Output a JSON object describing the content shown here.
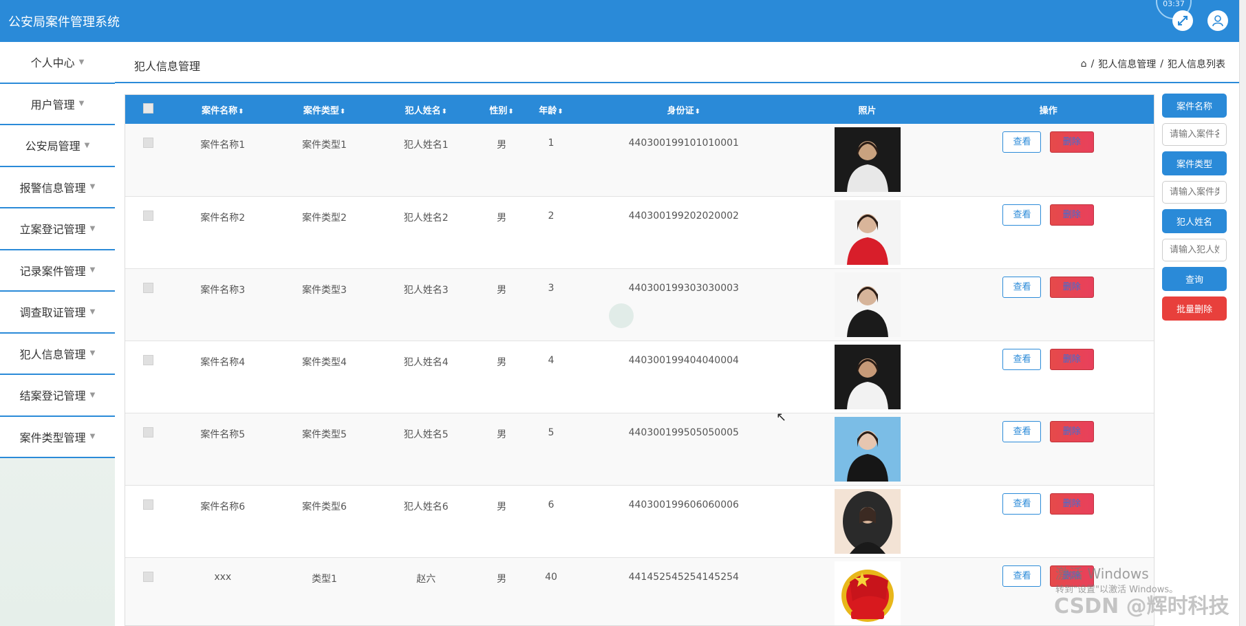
{
  "app": {
    "title": "公安局案件管理系统",
    "clock": "03:37"
  },
  "sidebar": {
    "items": [
      {
        "label": "个人中心"
      },
      {
        "label": "用户管理"
      },
      {
        "label": "公安局管理"
      },
      {
        "label": "报警信息管理"
      },
      {
        "label": "立案登记管理"
      },
      {
        "label": "记录案件管理"
      },
      {
        "label": "调查取证管理"
      },
      {
        "label": "犯人信息管理"
      },
      {
        "label": "结案登记管理"
      },
      {
        "label": "案件类型管理"
      }
    ]
  },
  "header": {
    "page_title": "犯人信息管理",
    "breadcrumb": [
      "犯人信息管理",
      "犯人信息列表"
    ],
    "separator": "/"
  },
  "table": {
    "columns": [
      "案件名称",
      "案件类型",
      "犯人姓名",
      "性别",
      "年龄",
      "身份证",
      "照片",
      "操作"
    ],
    "sortable": [
      true,
      true,
      true,
      true,
      true,
      true,
      false,
      false
    ],
    "view_label": "查看",
    "delete_label": "删除",
    "rows": [
      {
        "case_name": "案件名称1",
        "case_type": "案件类型1",
        "criminal_name": "犯人姓名1",
        "gender": "男",
        "age": "1",
        "id_card": "440300199101010001",
        "photo": "man-in-suit-photo"
      },
      {
        "case_name": "案件名称2",
        "case_type": "案件类型2",
        "criminal_name": "犯人姓名2",
        "gender": "男",
        "age": "2",
        "id_card": "440300199202020002",
        "photo": "woman-red-jacket-photo"
      },
      {
        "case_name": "案件名称3",
        "case_type": "案件类型3",
        "criminal_name": "犯人姓名3",
        "gender": "男",
        "age": "3",
        "id_card": "440300199303030003",
        "photo": "woman-black-suit-photo"
      },
      {
        "case_name": "案件名称4",
        "case_type": "案件类型4",
        "criminal_name": "犯人姓名4",
        "gender": "男",
        "age": "4",
        "id_card": "440300199404040004",
        "photo": "woman-white-suit-photo"
      },
      {
        "case_name": "案件名称5",
        "case_type": "案件类型5",
        "criminal_name": "犯人姓名5",
        "gender": "男",
        "age": "5",
        "id_card": "440300199505050005",
        "photo": "woman-blue-background-photo"
      },
      {
        "case_name": "案件名称6",
        "case_type": "案件类型6",
        "criminal_name": "犯人姓名6",
        "gender": "男",
        "age": "6",
        "id_card": "440300199606060006",
        "photo": "woman-oval-portrait-photo"
      },
      {
        "case_name": "xxx",
        "case_type": "类型1",
        "criminal_name": "赵六",
        "gender": "男",
        "age": "40",
        "id_card": "441452545254145254",
        "photo": "youth-league-emblem-photo"
      }
    ]
  },
  "search": {
    "case_name_label": "案件名称",
    "case_name_placeholder": "请输入案件名称",
    "case_type_label": "案件类型",
    "case_type_placeholder": "请输入案件类型",
    "criminal_name_label": "犯人姓名",
    "criminal_name_placeholder": "请输入犯人姓名",
    "query_label": "查询",
    "batch_delete_label": "批量删除"
  },
  "overlay": {
    "activate_title": "激活 Windows",
    "activate_sub": "转到\"设置\"以激活 Windows。",
    "csdn": "CSDN @辉时科技"
  },
  "colors": {
    "primary": "#2a8ad8",
    "danger": "#e8403c"
  }
}
